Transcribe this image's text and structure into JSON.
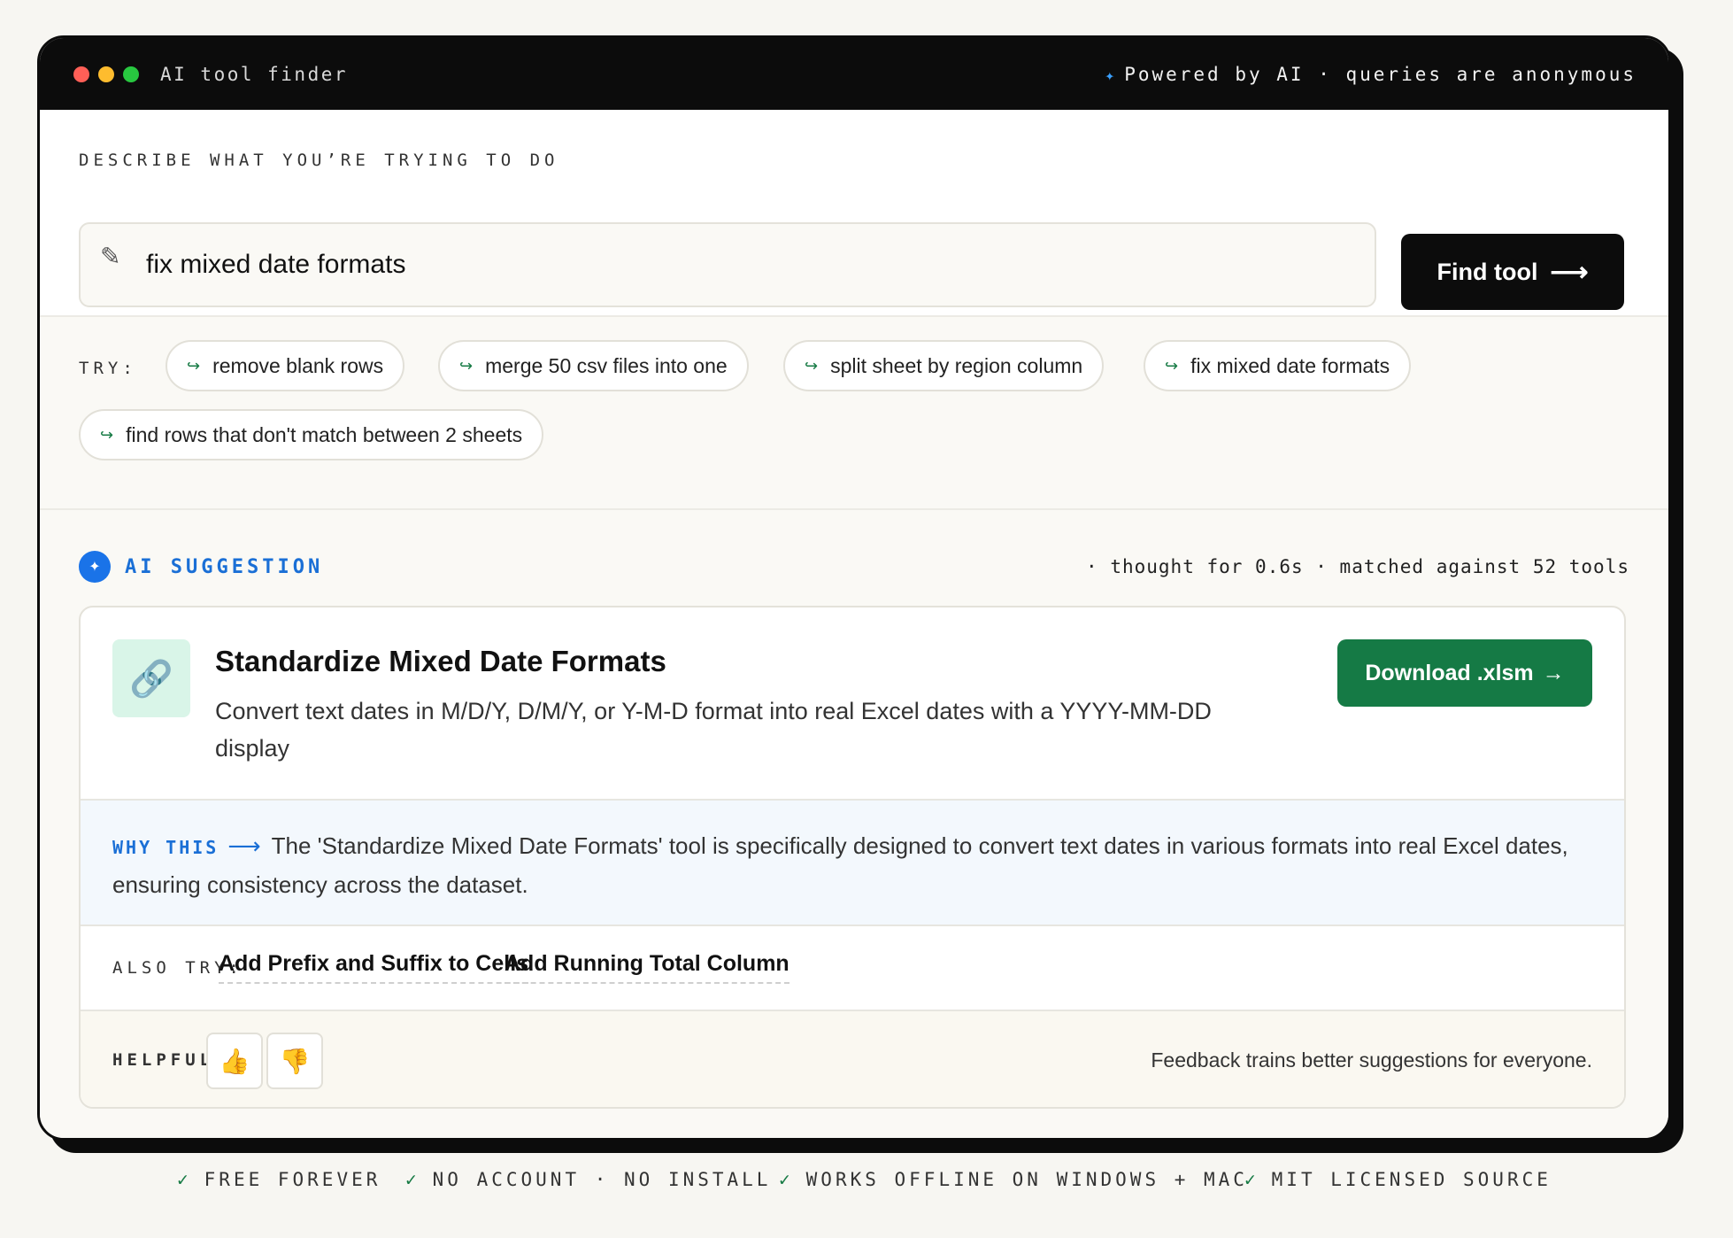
{
  "window": {
    "title": "AI tool finder",
    "powered_icon": "✦",
    "powered_text": "Powered by AI · queries are anonymous"
  },
  "search": {
    "label": "DESCRIBE WHAT YOU’RE TRYING TO DO",
    "pencil_icon": "✎",
    "value": "fix mixed date formats",
    "button_label": "Find tool",
    "button_arrow": "⟶"
  },
  "suggestions": {
    "label": "TRY:",
    "chip_icon": "↪",
    "chips": [
      "remove blank rows",
      "merge 50 csv files into one",
      "split sheet by region column",
      "fix mixed date formats",
      "find rows that don't match between 2 sheets"
    ]
  },
  "ai": {
    "badge_icon": "✦",
    "title": "AI SUGGESTION",
    "meta": "· thought for 0.6s · matched against 52 tools",
    "result": {
      "icon": "🔗",
      "title": "Standardize Mixed Date Formats",
      "description": "Convert text dates in M/D/Y, D/M/Y, or Y-M-D format into real Excel dates with a YYYY-MM-DD display",
      "download_label": "Download .xlsm",
      "download_arrow": "→"
    },
    "why": {
      "label": "WHY THIS",
      "arrow": "⟶",
      "text": "The 'Standardize Mixed Date Formats' tool is specifically designed to convert text dates in various formats into real Excel dates, ensuring consistency across the dataset."
    },
    "also_try": {
      "label": "ALSO TRY:",
      "links": [
        "Add Prefix and Suffix to Cells",
        "Add Running Total Column"
      ]
    },
    "helpful": {
      "label": "HELPFUL?",
      "thumbs_up": "👍",
      "thumbs_down": "👎",
      "note": "Feedback trains better suggestions for everyone."
    }
  },
  "footer": {
    "check_icon": "✓",
    "items": [
      "FREE FOREVER",
      "NO ACCOUNT · NO INSTALL",
      "WORKS OFFLINE ON WINDOWS + MAC",
      "MIT LICENSED SOURCE"
    ]
  },
  "colors": {
    "accent_blue": "#1a6fd6",
    "accent_green": "#157a45",
    "dark": "#0c0c0c"
  }
}
